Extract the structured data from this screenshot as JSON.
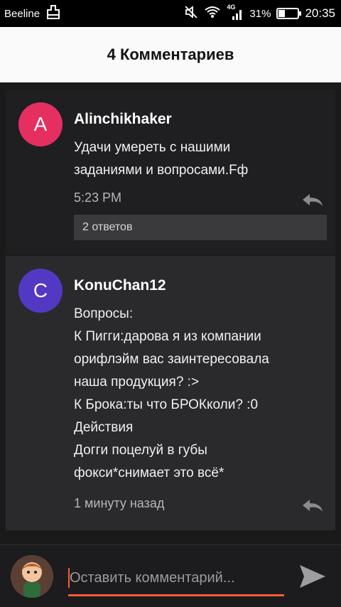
{
  "status_bar": {
    "carrier": "Beeline",
    "battery_percent": "31%",
    "battery_level": 0.31,
    "time": "20:35",
    "network": "4G"
  },
  "header": {
    "title": "4 Комментариев"
  },
  "comments": [
    {
      "avatar_letter": "A",
      "avatar_color": "#e52f61",
      "author": "Alinchikhaker",
      "lines": [
        "Удачи умереть с нашими",
        "заданиями и вопросами.Fф"
      ],
      "time": "5:23 PM",
      "replies_label": "2 ответов"
    },
    {
      "avatar_letter": "C",
      "avatar_color": "#5338c4",
      "author": "KonuChan12",
      "lines": [
        "Вопросы:",
        "К Пигги:дарова я из компании",
        "орифлэйм вас заинтересовала",
        "наша продукция? :>",
        "К Брока:ты что БРОКколи? :0",
        "Действия",
        "Догги поцелуй в губы",
        "фокси*снимает это всё*"
      ],
      "time": "1 минуту назад"
    }
  ],
  "composer": {
    "placeholder": "Оставить комментарий..."
  },
  "colors": {
    "accent": "#ff5a36"
  }
}
